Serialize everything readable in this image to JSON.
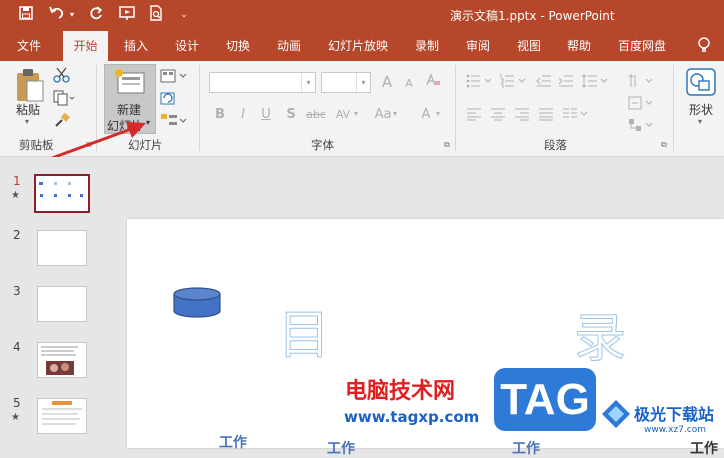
{
  "title": {
    "document": "演示文稿1.pptx",
    "separator": " - ",
    "app": "PowerPoint"
  },
  "tabs": [
    "文件",
    "开始",
    "插入",
    "设计",
    "切换",
    "动画",
    "幻灯片放映",
    "录制",
    "审阅",
    "视图",
    "帮助",
    "百度网盘"
  ],
  "active_tab": "开始",
  "ribbon": {
    "paste_label": "粘贴",
    "new_slide_line1": "新建",
    "new_slide_line2": "幻灯片",
    "shape_label": "形状",
    "groups": {
      "clipboard": "剪贴板",
      "slides": "幻灯片",
      "font": "字体",
      "paragraph": "段落"
    },
    "font_buttons": [
      "B",
      "I",
      "U",
      "S",
      "abc",
      "AV",
      "Aa",
      "A"
    ],
    "grow_font": "A",
    "shrink_font": "A"
  },
  "slides": {
    "numbers": [
      "1",
      "2",
      "3",
      "4",
      "5"
    ],
    "selected": "1",
    "star": "★"
  },
  "slide": {
    "heading_left": "目",
    "heading_right": "录",
    "bottom_words": [
      "工作",
      "工作",
      "工作",
      "工作"
    ]
  },
  "watermark": {
    "brand": "电脑技术网",
    "url": "www.tagxp.com",
    "tag": "TAG",
    "site2": "极光下载站",
    "site2_url": "www.xz7.com"
  },
  "colors": {
    "accent": "#b7472a",
    "selection": "#8b1f2b",
    "cylinder": "#4472c4"
  }
}
